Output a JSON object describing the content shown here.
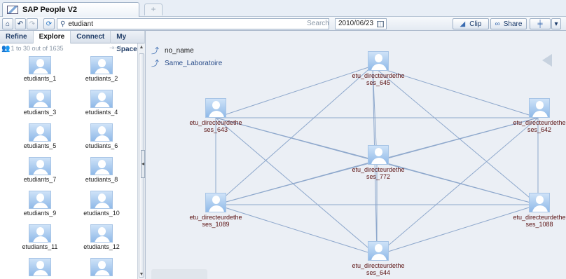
{
  "window": {
    "title": "SAP People V2"
  },
  "toolbar": {
    "query": "etudiant",
    "search_label": "Search",
    "date": "2010/06/23",
    "clip_label": "Clip",
    "share_label": "Share"
  },
  "panel": {
    "tabs": [
      "Refine",
      "Explore",
      "Connect",
      "My Space"
    ],
    "result_count": "1 to 30 out of 1635",
    "people": [
      "etudiants_1",
      "etudiants_2",
      "etudiants_3",
      "etudiants_4",
      "etudiants_5",
      "etudiants_6",
      "etudiants_7",
      "etudiants_8",
      "etudiants_9",
      "etudiants_10",
      "etudiants_11",
      "etudiants_12"
    ]
  },
  "graph": {
    "legend": [
      "no_name",
      "Same_Laboratoire"
    ],
    "nodes": [
      {
        "line1": "etu_directeurdethe",
        "line2": "ses_645"
      },
      {
        "line1": "etu_directeurdethe",
        "line2": "ses_643"
      },
      {
        "line1": "etu_directeurdethe",
        "line2": "ses_642"
      },
      {
        "line1": "etu_directeurdethe",
        "line2": "ses_772"
      },
      {
        "line1": "etu_directeurdethe",
        "line2": "ses_1089"
      },
      {
        "line1": "etu_directeurdethe",
        "line2": "ses_1088"
      },
      {
        "line1": "etu_directeurdethe",
        "line2": "ses_644"
      }
    ]
  },
  "colors": {
    "edge": "#8ea8cc",
    "node_label": "#5a1010",
    "accent": "#3a6bb0"
  },
  "icons": [
    "home-icon",
    "back-icon",
    "forward-icon",
    "refresh-icon",
    "search-icon",
    "calendar-icon",
    "clip-icon",
    "share-icon",
    "settings-icon",
    "dropdown-icon",
    "people-icon",
    "relation-icon"
  ]
}
